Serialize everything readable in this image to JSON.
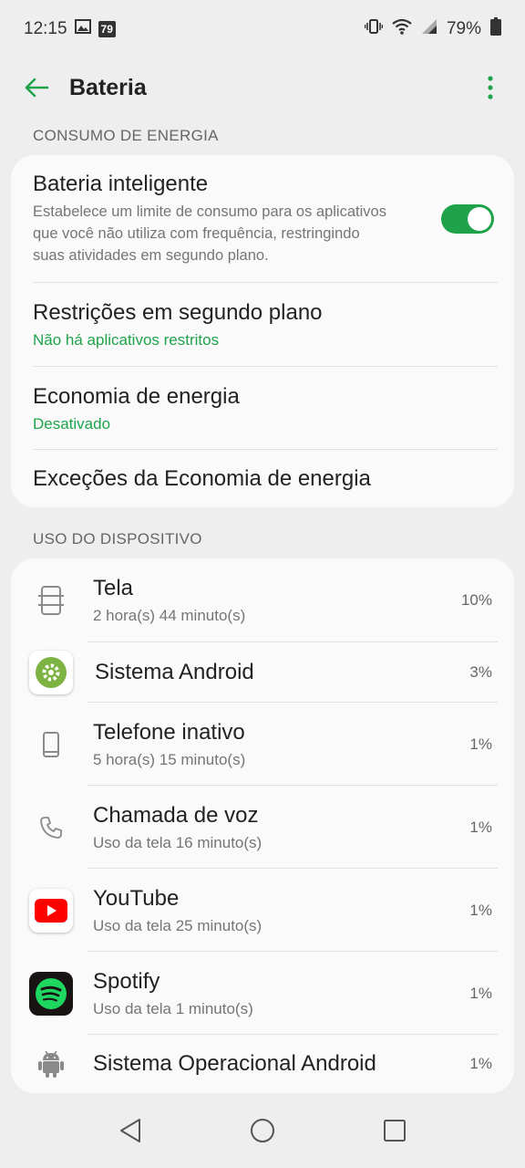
{
  "status_bar": {
    "time": "12:15",
    "badge": "79",
    "battery_percent": "79%"
  },
  "header": {
    "title": "Bateria"
  },
  "colors": {
    "accent": "#1fa34a",
    "background": "#eeeeee",
    "card": "#fafafa"
  },
  "sections": {
    "consumption_label": "CONSUMO DE ENERGIA",
    "usage_label": "USO DO DISPOSITIVO"
  },
  "consumption": {
    "smart_battery": {
      "title": "Bateria inteligente",
      "description": "Estabelece um limite de consumo para os aplicativos que você não utiliza com frequência, restringindo suas atividades em segundo plano.",
      "enabled": true
    },
    "background_restrictions": {
      "title": "Restrições em segundo plano",
      "status": "Não há aplicativos restritos"
    },
    "power_saving": {
      "title": "Economia de energia",
      "status": "Desativado"
    },
    "power_saving_exceptions": {
      "title": "Exceções da Economia de energia"
    }
  },
  "usage": [
    {
      "name": "Tela",
      "detail": "2 hora(s) 44 minuto(s)",
      "percent": "10%",
      "icon": "screen-icon"
    },
    {
      "name": "Sistema Android",
      "detail": "",
      "percent": "3%",
      "icon": "android-system-icon"
    },
    {
      "name": "Telefone inativo",
      "detail": "5 hora(s) 15 minuto(s)",
      "percent": "1%",
      "icon": "phone-idle-icon"
    },
    {
      "name": "Chamada de voz",
      "detail": "Uso da tela 16 minuto(s)",
      "percent": "1%",
      "icon": "phone-call-icon"
    },
    {
      "name": "YouTube",
      "detail": "Uso da tela 25 minuto(s)",
      "percent": "1%",
      "icon": "youtube-icon"
    },
    {
      "name": "Spotify",
      "detail": "Uso da tela 1 minuto(s)",
      "percent": "1%",
      "icon": "spotify-icon"
    },
    {
      "name": "Sistema Operacional Android",
      "detail": "",
      "percent": "1%",
      "icon": "android-os-icon"
    }
  ]
}
